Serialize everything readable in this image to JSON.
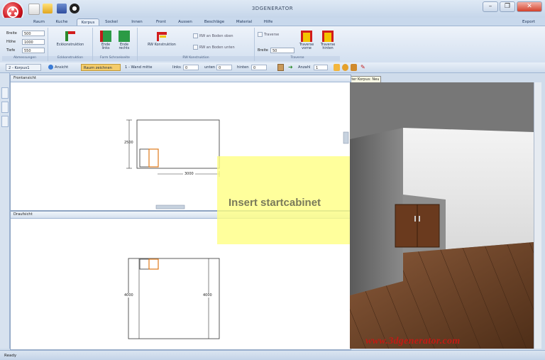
{
  "window": {
    "title": "3DGENERATOR",
    "minimize": "–",
    "restore": "❐",
    "close": "✕"
  },
  "tabs": [
    "Raum",
    "Kuche",
    "Korpus",
    "Sockel",
    "Innen",
    "Front",
    "Aussen",
    "Beschläge",
    "Material",
    "Hilfe"
  ],
  "active_tab": "Korpus",
  "export_label": "Export",
  "ribbon": {
    "dims": {
      "breite_label": "Breite",
      "breite": "500",
      "hoehe_label": "Höhe",
      "hoehe": "1000",
      "tiefe_label": "Tiefe",
      "tiefe": "550",
      "group": "Abmessungen"
    },
    "eck": {
      "button": "Eckkonstruktion",
      "group": "Eckkonstruktion"
    },
    "ende": {
      "links": "Ende links",
      "rechts": "Ende rechts",
      "group": "Form Schrankseite"
    },
    "rw": {
      "button": "RW Konstruktion",
      "chk1": "RW an Boden oben",
      "chk2": "RW an Boden unten",
      "group": "RW Konstruktion"
    },
    "traverse": {
      "chk": "Traverse",
      "breite_label": "Breite",
      "breite": "50",
      "vorne": "Traverse vorne",
      "hinten": "Traverse hinten",
      "group": "Traverse"
    }
  },
  "toolbar": {
    "korpus": "2 - Korpus1",
    "ansicht": "Ansicht",
    "raum": "Raum zeichnen",
    "wand": "1 - Wand mitte",
    "links_label": "links",
    "links": "0",
    "unten_label": "unten",
    "unten": "0",
    "hinten_label": "hinten",
    "hinten": "0",
    "anzahl_label": "Anzahl",
    "anzahl": "1"
  },
  "tooltip": "Nächster Korpus: Neu",
  "front_view": {
    "title": "Frontansicht",
    "height_dim": "2500",
    "width_dim": "3000"
  },
  "top_view": {
    "title": "Draufsicht",
    "left_dim": "4000",
    "right_dim": "4000"
  },
  "overlay_text": "Insert startcabinet",
  "watermark": "www.3dgenerator.com",
  "status": "Ready"
}
